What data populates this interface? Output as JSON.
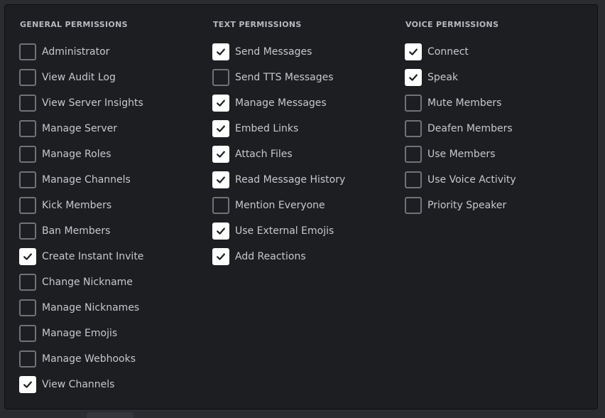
{
  "colors": {
    "background": "#2a2c30",
    "panel": "#1d1e22",
    "heading_text": "#b6b9be",
    "label_text": "#c5c8cc",
    "checkbox_border": "#6f7277",
    "checkbox_checked_fill": "#ffffff",
    "checkmark": "#1d1e22"
  },
  "sections": [
    {
      "title": "GENERAL PERMISSIONS",
      "permissions": [
        {
          "label": "Administrator",
          "checked": false
        },
        {
          "label": "View Audit Log",
          "checked": false
        },
        {
          "label": "View Server Insights",
          "checked": false
        },
        {
          "label": "Manage Server",
          "checked": false
        },
        {
          "label": "Manage Roles",
          "checked": false
        },
        {
          "label": "Manage Channels",
          "checked": false
        },
        {
          "label": "Kick Members",
          "checked": false
        },
        {
          "label": "Ban Members",
          "checked": false
        },
        {
          "label": "Create Instant Invite",
          "checked": true
        },
        {
          "label": "Change Nickname",
          "checked": false
        },
        {
          "label": "Manage Nicknames",
          "checked": false
        },
        {
          "label": "Manage Emojis",
          "checked": false
        },
        {
          "label": "Manage Webhooks",
          "checked": false
        },
        {
          "label": "View Channels",
          "checked": true
        }
      ]
    },
    {
      "title": "TEXT PERMISSIONS",
      "permissions": [
        {
          "label": "Send Messages",
          "checked": true
        },
        {
          "label": "Send TTS Messages",
          "checked": false
        },
        {
          "label": "Manage Messages",
          "checked": true
        },
        {
          "label": "Embed Links",
          "checked": true
        },
        {
          "label": "Attach Files",
          "checked": true
        },
        {
          "label": "Read Message History",
          "checked": true
        },
        {
          "label": "Mention Everyone",
          "checked": false
        },
        {
          "label": "Use External Emojis",
          "checked": true
        },
        {
          "label": "Add Reactions",
          "checked": true
        }
      ]
    },
    {
      "title": "VOICE PERMISSIONS",
      "permissions": [
        {
          "label": "Connect",
          "checked": true
        },
        {
          "label": "Speak",
          "checked": true
        },
        {
          "label": "Mute Members",
          "checked": false
        },
        {
          "label": "Deafen Members",
          "checked": false
        },
        {
          "label": "Use Members",
          "checked": false
        },
        {
          "label": "Use Voice Activity",
          "checked": false
        },
        {
          "label": "Priority Speaker",
          "checked": false
        }
      ]
    }
  ]
}
